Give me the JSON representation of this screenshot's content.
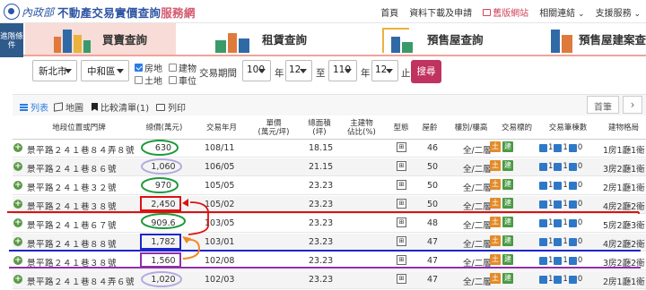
{
  "header": {
    "ministry": "內政部",
    "title_main": "不動產交易實價查詢",
    "title_hl": "服務網",
    "nav": [
      "首頁",
      "資料下載及申請",
      "舊版網站",
      "相關連結",
      "支援服務"
    ]
  },
  "sidehelp": "進階條件",
  "tabs": [
    "買賣查詢",
    "租賃查詢",
    "預售屋查詢",
    "預售屋建案查"
  ],
  "filters": {
    "city": "新北市",
    "district": "中和區",
    "type_house": "房地",
    "type_building": "建物",
    "type_land": "土地",
    "type_parking": "車位",
    "period_label": "交易期間",
    "from_year": "100",
    "from_month": "12",
    "to_year": "110",
    "to_month": "12",
    "year_label": "年",
    "to_label": "至",
    "end_label": "止",
    "search": "搜尋"
  },
  "toolbar": {
    "list": "列表",
    "map": "地圖",
    "compare": "比較清單(1)",
    "print": "列印",
    "page": "首筆",
    "next": "›"
  },
  "columns": [
    "地段位置或門牌",
    "總價(萬元)",
    "交易年月",
    "單價\n(萬元/坪)",
    "總面積\n(坪)",
    "主建物\n佔比(%)",
    "型態",
    "屋齡",
    "樓別/樓高",
    "交易標的",
    "交易筆棟數",
    "建物格局"
  ],
  "rows": [
    {
      "addr": "景平路２４１巷８４弄８號",
      "price": "630",
      "ym": "108/11",
      "area": "18.15",
      "age": "46",
      "floor": "全/二層",
      "units": [
        "1",
        "1",
        "0"
      ],
      "layout": "1房1廳1衛"
    },
    {
      "addr": "景平路２４１巷８６號",
      "price": "1,060",
      "ym": "106/05",
      "area": "21.15",
      "age": "50",
      "floor": "全/二層",
      "units": [
        "1",
        "1",
        "0"
      ],
      "layout": "3房2廳1衛"
    },
    {
      "addr": "景平路２４１巷３２號",
      "price": "970",
      "ym": "105/05",
      "area": "23.23",
      "age": "50",
      "floor": "全/二層",
      "units": [
        "1",
        "1",
        "0"
      ],
      "layout": "2房1廳1衛"
    },
    {
      "addr": "景平路２４１巷３８號",
      "price": "2,450",
      "ym": "105/02",
      "area": "23.23",
      "age": "50",
      "floor": "全/二層",
      "units": [
        "1",
        "1",
        "0"
      ],
      "layout": "4房2廳2衛"
    },
    {
      "addr": "景平路２４１巷６７號",
      "price": "909.6",
      "ym": "103/05",
      "area": "23.23",
      "age": "48",
      "floor": "全/二層",
      "units": [
        "1",
        "1",
        "0"
      ],
      "layout": "5房2廳3衛"
    },
    {
      "addr": "景平路２４１巷８８號",
      "price": "1,782",
      "ym": "103/01",
      "area": "23.23",
      "age": "47",
      "floor": "全/二層",
      "units": [
        "1",
        "1",
        "0"
      ],
      "layout": "4房2廳2衛"
    },
    {
      "addr": "景平路２４１巷３８號",
      "price": "1,560",
      "ym": "102/08",
      "area": "23.23",
      "age": "47",
      "floor": "全/二層",
      "units": [
        "1",
        "1",
        "0"
      ],
      "layout": "3房2廳2衛"
    },
    {
      "addr": "景平路２４１巷８４弄６號",
      "price": "1,020",
      "ym": "102/03",
      "area": "23.23",
      "age": "47",
      "floor": "全/二層",
      "units": [
        "1",
        "1",
        "0"
      ],
      "layout": "2房1廳1衛"
    }
  ],
  "row_pattern_icon": "floorplan-icon",
  "row_object_label": "土",
  "row_object_label2": "建",
  "colors": {
    "accent": "#c0325f",
    "tab_active": "#f8dcd7",
    "brand": "#2e55a3"
  }
}
